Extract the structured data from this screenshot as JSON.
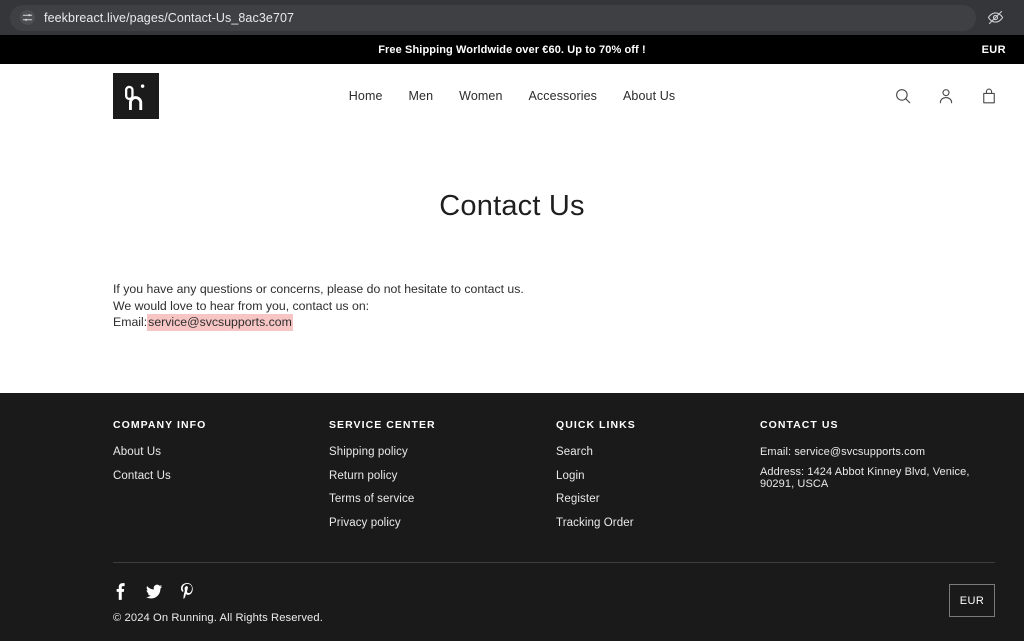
{
  "browser": {
    "url": "feekbreact.live/pages/Contact-Us_8ac3e707",
    "site_settings_icon": "tune-sliders-icon",
    "right_icon": "eye-hidden-icon"
  },
  "announcement": {
    "text": "Free Shipping Worldwide over €60. Up to 70% off !",
    "currency": "EUR"
  },
  "header": {
    "logo_alt": "on-running-logo",
    "nav": [
      {
        "label": "Home"
      },
      {
        "label": "Men"
      },
      {
        "label": "Women"
      },
      {
        "label": "Accessories"
      },
      {
        "label": "About Us"
      }
    ],
    "actions": [
      {
        "name": "search-icon"
      },
      {
        "name": "account-icon"
      },
      {
        "name": "cart-icon"
      }
    ]
  },
  "main": {
    "title": "Contact Us",
    "line1": "If you have any questions or concerns, please do not hesitate to contact us.",
    "line2": "We would love to hear from you, contact us on:",
    "email_label": "Email:",
    "email": "service@svcsupports.com",
    "highlight_color": "#f6c5c4"
  },
  "footer": {
    "columns": [
      {
        "heading": "COMPANY INFO",
        "links": [
          {
            "label": "About Us"
          },
          {
            "label": "Contact Us"
          }
        ]
      },
      {
        "heading": "SERVICE CENTER",
        "links": [
          {
            "label": "Shipping policy"
          },
          {
            "label": "Return policy"
          },
          {
            "label": "Terms of service"
          },
          {
            "label": "Privacy policy"
          }
        ]
      },
      {
        "heading": "QUICK LINKS",
        "links": [
          {
            "label": "Search"
          },
          {
            "label": "Login"
          },
          {
            "label": "Register"
          },
          {
            "label": "Tracking Order"
          }
        ]
      }
    ],
    "contact": {
      "heading": "CONTACT US",
      "email_line": "Email: service@svcsupports.com",
      "address_line": "Address: 1424 Abbot Kinney Blvd, Venice, 90291, USCA"
    },
    "social": [
      {
        "name": "facebook-icon"
      },
      {
        "name": "twitter-icon"
      },
      {
        "name": "pinterest-icon"
      }
    ],
    "copyright": "© 2024 On Running. All Rights Reserved.",
    "currency": "EUR",
    "background_color": "#1a1a1a"
  }
}
